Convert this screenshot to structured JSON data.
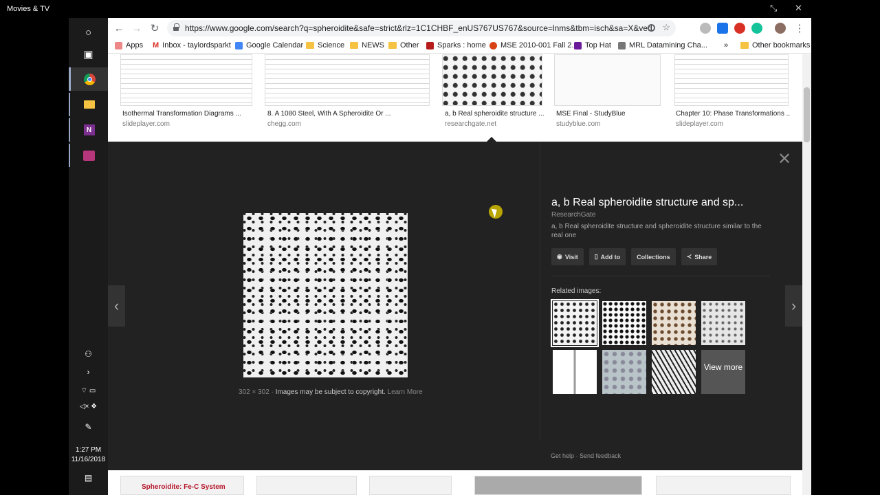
{
  "app": {
    "title": "Movies & TV"
  },
  "browser": {
    "url": "https://www.google.com/search?q=spheroidite&safe=strict&rlz=1C1CHBF_enUS767US767&source=lnms&tbm=isch&sa=X&ved=0ahUK...",
    "bookmarks": [
      "Apps",
      "Inbox - taylordsparkt",
      "Google Calendar",
      "Science",
      "NEWS",
      "Other",
      "Sparks : home",
      "MSE 2010-001 Fall 2...",
      "Top Hat",
      "MRL Datamining Cha...",
      "»",
      "Other bookmarks"
    ],
    "ext_badge": "2"
  },
  "results_row": [
    {
      "title": "Isothermal Transformation Diagrams ...",
      "source": "slideplayer.com"
    },
    {
      "title": "8. A 1080 Steel, With A Spheroidite Or ...",
      "source": "chegg.com"
    },
    {
      "title": "a, b Real spheroidite structure ...",
      "source": "researchgate.net"
    },
    {
      "title": "MSE Final - StudyBlue",
      "source": "studyblue.com"
    },
    {
      "title": "Chapter 10: Phase Transformations ...",
      "source": "slideplayer.com"
    }
  ],
  "preview": {
    "title": "a, b Real spheroidite structure and sp...",
    "source": "ResearchGate",
    "description": "a, b Real spheroidite structure and spheroidite structure similar to the real one",
    "buttons": [
      "Visit",
      "Add to",
      "Collections",
      "Share"
    ],
    "related_label": "Related images:",
    "view_more": "View more",
    "dims": "302 × 302",
    "copyright": "Images may be subject to copyright.",
    "learn_more": "Learn More",
    "get_help": "Get help",
    "send_feedback": "Send feedback"
  },
  "bottom_row": {
    "first_label": "Spheroidite:  Fe-C System"
  },
  "taskbar": {
    "time": "1:27 PM",
    "date": "11/16/2018"
  }
}
